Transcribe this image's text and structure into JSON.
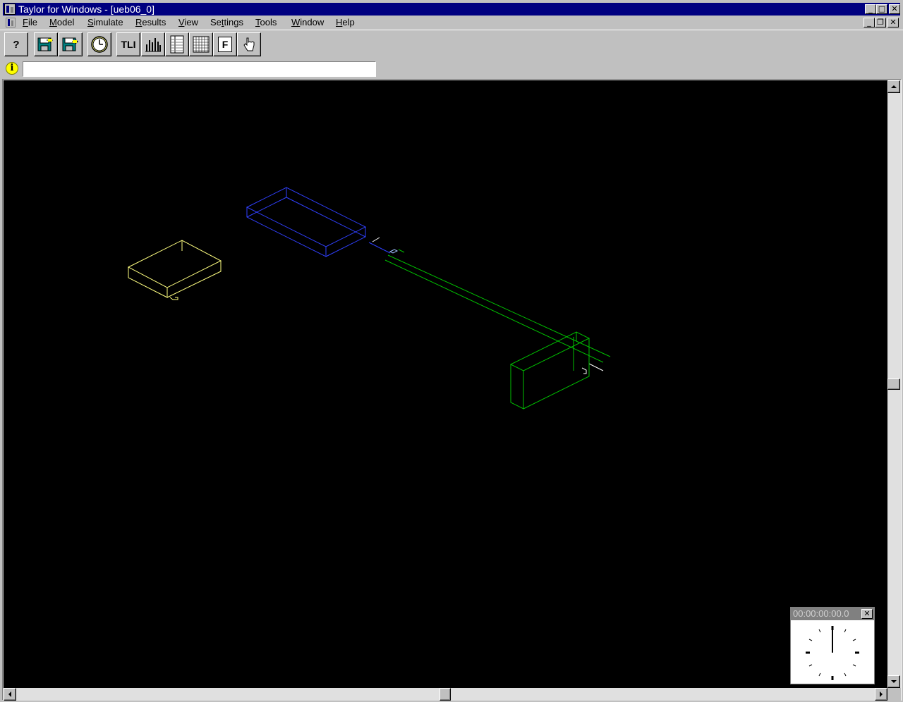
{
  "window": {
    "title": "Taylor for Windows - [ueb06_0]",
    "minimize_glyph": "_",
    "restore_glyph": "❐",
    "close_glyph": "✕"
  },
  "menu": {
    "items": [
      {
        "label": "File",
        "accel": "F"
      },
      {
        "label": "Model",
        "accel": "M"
      },
      {
        "label": "Simulate",
        "accel": "S"
      },
      {
        "label": "Results",
        "accel": "R"
      },
      {
        "label": "View",
        "accel": "V"
      },
      {
        "label": "Settings",
        "accel": "t"
      },
      {
        "label": "Tools",
        "accel": "T"
      },
      {
        "label": "Window",
        "accel": "W"
      },
      {
        "label": "Help",
        "accel": "H"
      }
    ]
  },
  "toolbar": {
    "help_label": "?",
    "tli_label": "TLI",
    "f_label": "F",
    "buttons": [
      "help-icon",
      "open-file-icon",
      "save-file-icon",
      "clock-icon",
      "tli-text",
      "bar-chart-icon",
      "report-list-icon",
      "table-grid-icon",
      "f-box-icon",
      "hand-pointer-icon"
    ]
  },
  "infobar": {
    "icon": "info-icon",
    "icon_glyph": "i",
    "message": ""
  },
  "canvas": {
    "background": "#000000",
    "objects": [
      {
        "name": "yellow-box",
        "color": "#ffff80"
      },
      {
        "name": "blue-box",
        "color": "#0000ff"
      },
      {
        "name": "green-conveyor",
        "color": "#00c000"
      },
      {
        "name": "green-box",
        "color": "#00c000"
      }
    ]
  },
  "clock": {
    "time": "00:00:00:00.0",
    "close_glyph": "✕"
  },
  "colors": {
    "titlebar": "#000080",
    "face": "#c0c0c0",
    "info": "#ffff00"
  }
}
